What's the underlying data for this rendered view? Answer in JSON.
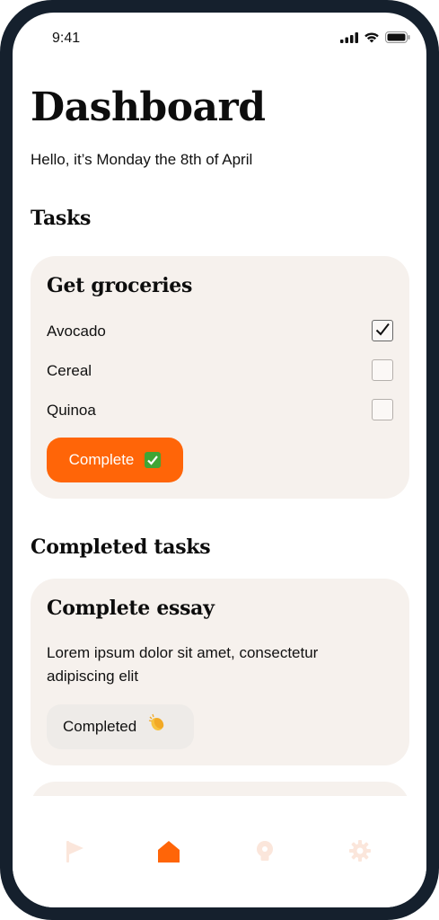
{
  "status_bar": {
    "time": "9:41"
  },
  "page": {
    "title": "Dashboard",
    "greeting": "Hello, it’s Monday the 8th of April"
  },
  "tasks": {
    "heading": "Tasks",
    "card": {
      "title": "Get groceries",
      "items": [
        {
          "label": "Avocado",
          "checked": true
        },
        {
          "label": "Cereal",
          "checked": false
        },
        {
          "label": "Quinoa",
          "checked": false
        }
      ],
      "button_label": "Complete",
      "button_icon": "white-check-mark-emoji"
    }
  },
  "completed_tasks": {
    "heading": "Completed tasks",
    "card": {
      "title": "Complete essay",
      "description": "Lorem ipsum dolor sit amet, consectetur adipiscing elit",
      "badge_label": "Completed",
      "badge_icon": "clapping-hands-emoji"
    }
  },
  "tab_bar": {
    "items": [
      {
        "icon": "flag-icon",
        "active": false
      },
      {
        "icon": "home-icon",
        "active": true
      },
      {
        "icon": "lightbulb-icon",
        "active": false
      },
      {
        "icon": "gear-icon",
        "active": false
      }
    ]
  },
  "colors": {
    "accent": "#ff6508",
    "card_background": "#f6f1ed",
    "frame": "#15202d",
    "inactive_icon": "#fbe3d6"
  }
}
